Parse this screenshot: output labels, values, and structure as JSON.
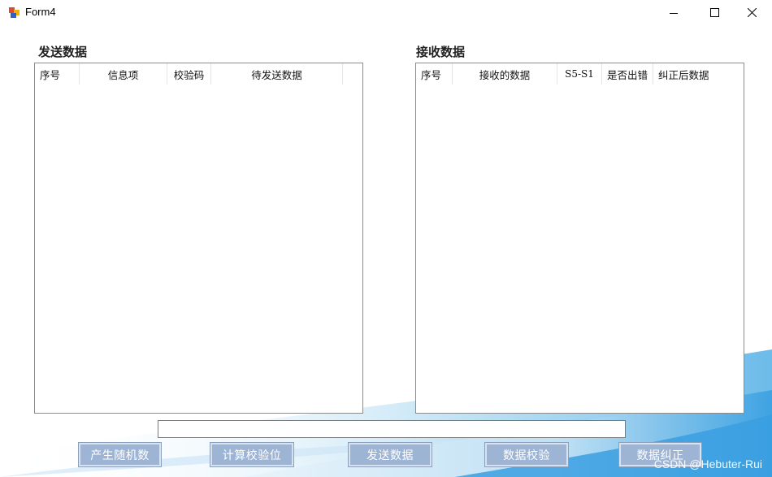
{
  "window": {
    "title": "Form4"
  },
  "send": {
    "title": "发送数据",
    "columns": [
      "序号",
      "信息项",
      "校验码",
      "待发送数据"
    ]
  },
  "receive": {
    "title": "接收数据",
    "columns": [
      "序号",
      "接收的数据",
      "S5-S1",
      "是否出错",
      "纠正后数据"
    ]
  },
  "input": {
    "value": ""
  },
  "buttons": {
    "generate_random": "产生随机数",
    "compute_check": "计算校验位",
    "send_data": "发送数据",
    "verify_data": "数据校验",
    "correct_data": "数据纠正"
  },
  "watermark": "CSDN @Hebuter-Rui",
  "colors": {
    "button_bg": "#9db4d4",
    "background_accent": "#4aa6e0"
  }
}
